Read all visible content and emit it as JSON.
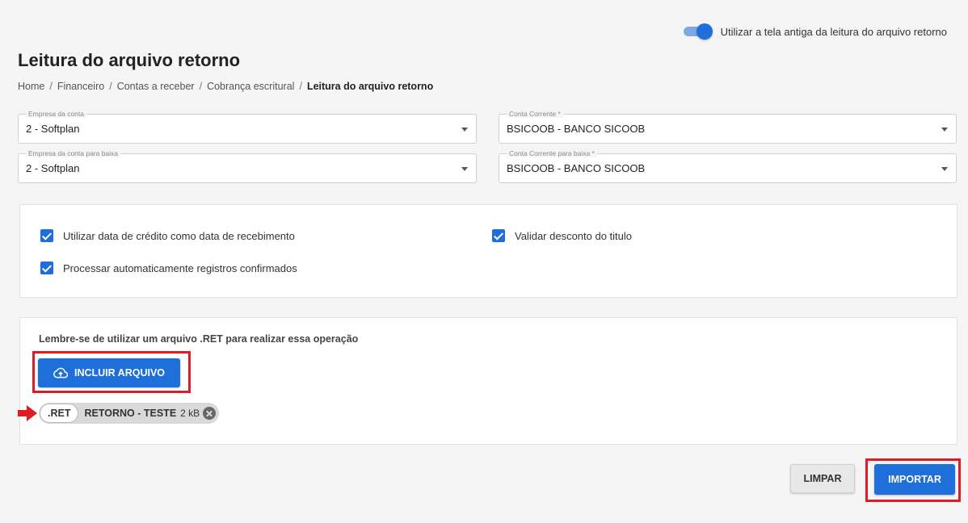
{
  "toggle": {
    "label": "Utilizar a tela antiga da leitura do arquivo retorno",
    "on": true
  },
  "page_title": "Leitura do arquivo retorno",
  "breadcrumb": [
    "Home",
    "Financeiro",
    "Contas a receber",
    "Cobrança escritural",
    "Leitura do arquivo retorno"
  ],
  "fields": {
    "empresa_conta": {
      "label": "Empresa da conta",
      "value": "2 - Softplan"
    },
    "conta_corrente": {
      "label": "Conta Corrente *",
      "value": "BSICOOB - BANCO SICOOB"
    },
    "empresa_conta_baixa": {
      "label": "Empresa da conta para baixa",
      "value": "2 - Softplan"
    },
    "conta_corrente_baixa": {
      "label": "Conta Corrente para baixa *",
      "value": "BSICOOB - BANCO SICOOB"
    }
  },
  "options": {
    "data_credito": {
      "label": "Utilizar data de crédito como data de recebimento",
      "checked": true
    },
    "validar_desconto": {
      "label": "Validar desconto do titulo",
      "checked": true
    },
    "processar_auto": {
      "label": "Processar automaticamente registros confirmados",
      "checked": true
    }
  },
  "upload": {
    "hint": "Lembre-se de utilizar um arquivo .RET para realizar essa operação",
    "button_label": "INCLUIR ARQUIVO",
    "file": {
      "extension": ".RET",
      "name": "RETORNO - TESTE",
      "size": "2 kB"
    }
  },
  "actions": {
    "clear_label": "LIMPAR",
    "import_label": "IMPORTAR"
  },
  "colors": {
    "primary": "#1e6fd9",
    "highlight": "#e01b24",
    "background": "#f5f5f5"
  }
}
